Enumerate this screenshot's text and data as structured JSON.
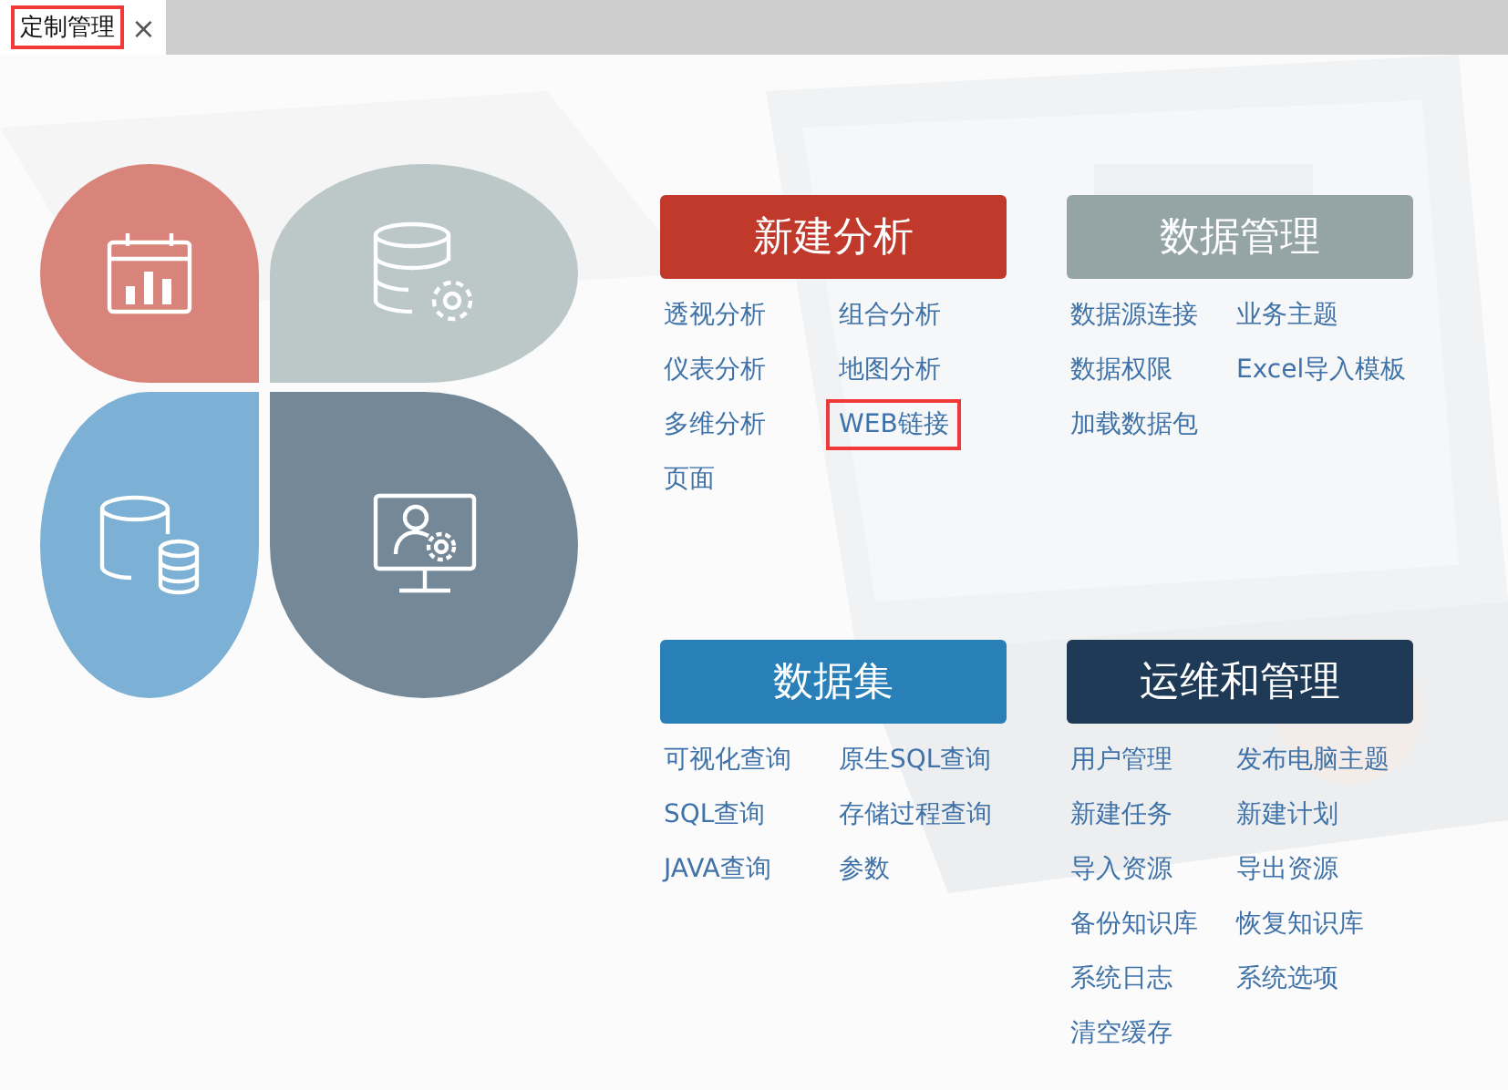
{
  "tab": {
    "label": "定制管理",
    "close": "×",
    "selected": true,
    "highlighted": true
  },
  "petals": [
    {
      "kind": "chart",
      "color": "#d9847a"
    },
    {
      "kind": "database-gear",
      "color": "#bcc8c8"
    },
    {
      "kind": "databases",
      "color": "#7cb0d4"
    },
    {
      "kind": "user-monitor",
      "color": "#758898"
    }
  ],
  "sections": [
    {
      "title": "新建分析",
      "color": "#c0392b",
      "links": [
        {
          "label": "透视分析",
          "highlighted": false
        },
        {
          "label": "组合分析",
          "highlighted": false
        },
        {
          "label": "仪表分析",
          "highlighted": false
        },
        {
          "label": "地图分析",
          "highlighted": false
        },
        {
          "label": "多维分析",
          "highlighted": false
        },
        {
          "label": "WEB链接",
          "highlighted": true
        },
        {
          "label": "页面",
          "highlighted": false
        }
      ]
    },
    {
      "title": "数据管理",
      "color": "#95a5a6",
      "links": [
        {
          "label": "数据源连接",
          "highlighted": false
        },
        {
          "label": "业务主题",
          "highlighted": false
        },
        {
          "label": "数据权限",
          "highlighted": false
        },
        {
          "label": "Excel导入模板",
          "highlighted": false
        },
        {
          "label": "加载数据包",
          "highlighted": false
        }
      ]
    },
    {
      "title": "数据集",
      "color": "#2980b9",
      "links": [
        {
          "label": "可视化查询",
          "highlighted": false
        },
        {
          "label": "原生SQL查询",
          "highlighted": false
        },
        {
          "label": "SQL查询",
          "highlighted": false
        },
        {
          "label": "存储过程查询",
          "highlighted": false
        },
        {
          "label": "JAVA查询",
          "highlighted": false
        },
        {
          "label": "参数",
          "highlighted": false
        }
      ]
    },
    {
      "title": "运维和管理",
      "color": "#1f3a56",
      "links": [
        {
          "label": "用户管理",
          "highlighted": false
        },
        {
          "label": "发布电脑主题",
          "highlighted": false
        },
        {
          "label": "新建任务",
          "highlighted": false
        },
        {
          "label": "新建计划",
          "highlighted": false
        },
        {
          "label": "导入资源",
          "highlighted": false
        },
        {
          "label": "导出资源",
          "highlighted": false
        },
        {
          "label": "备份知识库",
          "highlighted": false
        },
        {
          "label": "恢复知识库",
          "highlighted": false
        },
        {
          "label": "系统日志",
          "highlighted": false
        },
        {
          "label": "系统选项",
          "highlighted": false
        },
        {
          "label": "清空缓存",
          "highlighted": false
        }
      ]
    }
  ]
}
